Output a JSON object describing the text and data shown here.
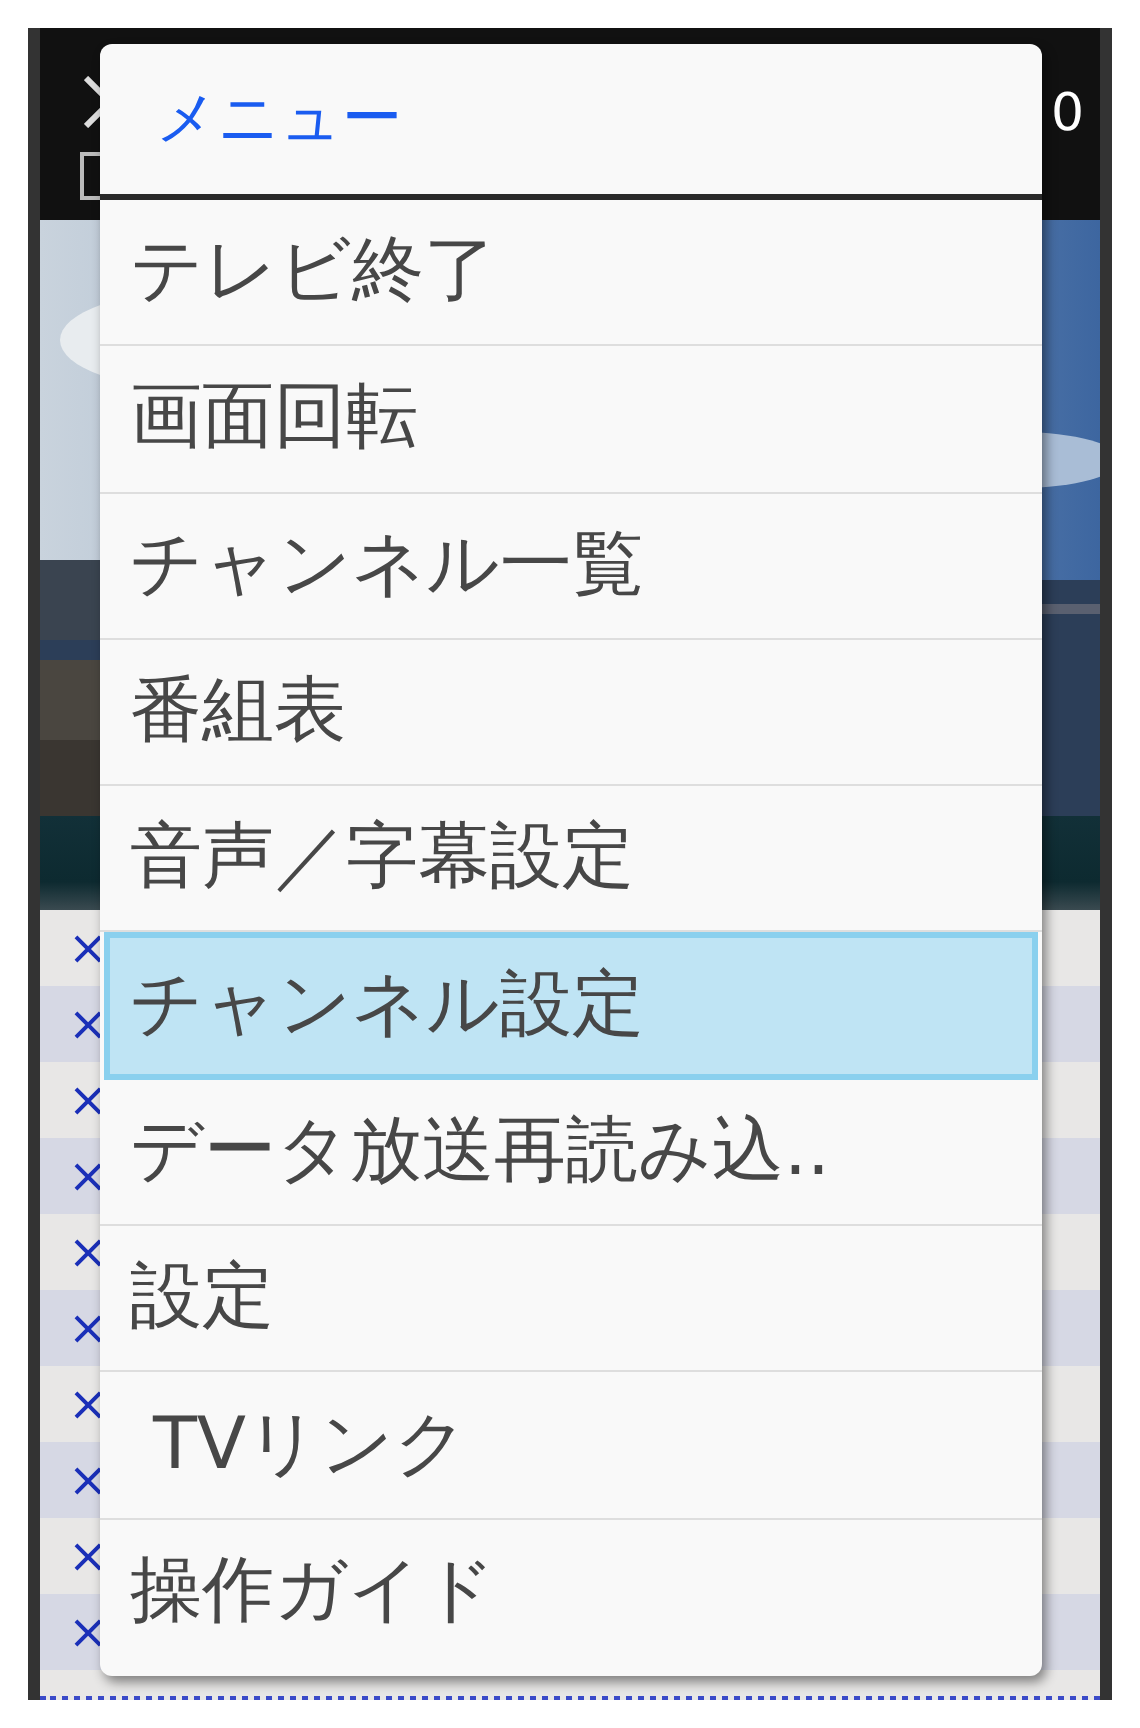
{
  "header": {
    "checkbox": {
      "checked": false
    },
    "count": "0"
  },
  "list_rows": [
    {
      "mark": "×"
    },
    {
      "mark": "×"
    },
    {
      "mark": "×"
    },
    {
      "mark": "×"
    },
    {
      "mark": "×"
    },
    {
      "mark": "×"
    },
    {
      "mark": "×"
    },
    {
      "mark": "×"
    },
    {
      "mark": "×"
    },
    {
      "mark": "×"
    }
  ],
  "menu": {
    "title": "メニュー",
    "items": [
      {
        "label": "テレビ終了",
        "selected": false
      },
      {
        "label": "画面回転",
        "selected": false
      },
      {
        "label": "チャンネル一覧",
        "selected": false
      },
      {
        "label": "番組表",
        "selected": false
      },
      {
        "label": "音声／字幕設定",
        "selected": false
      },
      {
        "label": "チャンネル設定",
        "selected": true
      },
      {
        "label": "データ放送再読み込..",
        "selected": false
      },
      {
        "label": "設定",
        "selected": false
      },
      {
        "label": " TVリンク",
        "selected": false
      },
      {
        "label": "操作ガイド",
        "selected": false
      }
    ]
  }
}
